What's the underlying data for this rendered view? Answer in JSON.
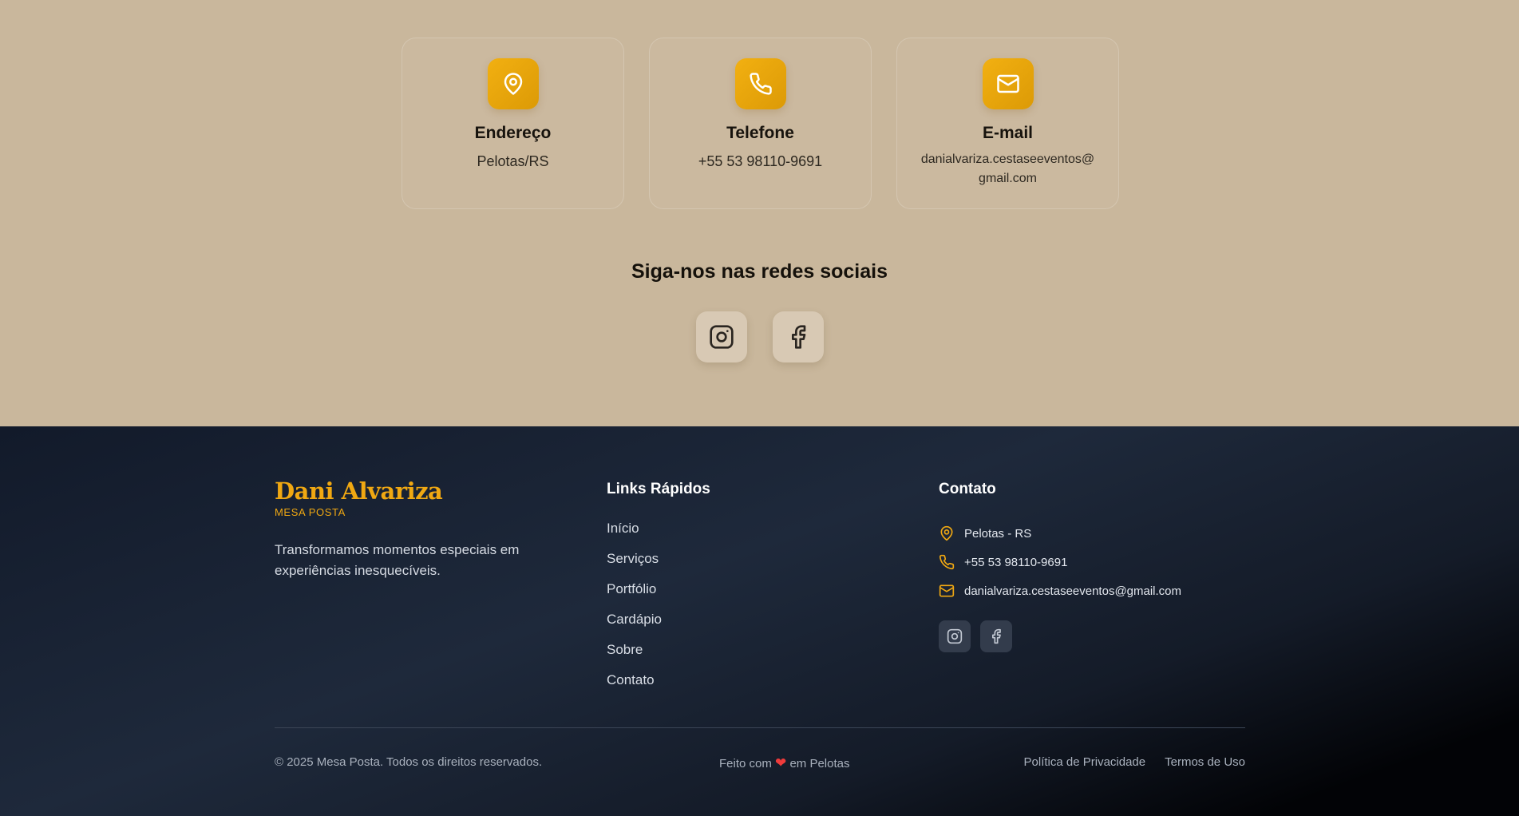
{
  "contact_cards": [
    {
      "title": "Endereço",
      "value": "Pelotas/RS",
      "icon": "map-pin-icon"
    },
    {
      "title": "Telefone",
      "value": "+55 53 98110-9691",
      "icon": "phone-icon"
    },
    {
      "title": "E-mail",
      "value": "danialvariza.cestaseeventos@gmail.com",
      "icon": "mail-icon"
    }
  ],
  "social": {
    "title": "Siga-nos nas redes sociais",
    "items": [
      {
        "icon": "instagram-icon"
      },
      {
        "icon": "facebook-icon"
      }
    ]
  },
  "footer": {
    "brand_name": "Dani Alvariza",
    "brand_sub": "MESA POSTA",
    "description": "Transformamos momentos especiais em experiências inesquecíveis.",
    "links_title": "Links Rápidos",
    "links": [
      "Início",
      "Serviços",
      "Portfólio",
      "Cardápio",
      "Sobre",
      "Contato"
    ],
    "contact_title": "Contato",
    "contact_items": [
      {
        "icon": "map-pin-icon",
        "text": "Pelotas - RS"
      },
      {
        "icon": "phone-icon",
        "text": "+55 53 98110-9691"
      },
      {
        "icon": "mail-icon",
        "text": "danialvariza.cestaseeventos@gmail.com"
      }
    ],
    "copyright": "© 2025 Mesa Posta. Todos os direitos reservados.",
    "made_with_prefix": "Feito com",
    "made_with_suffix": "em Pelotas",
    "privacy": "Política de Privacidade",
    "terms": "Termos de Uso"
  },
  "colors": {
    "accent": "#f0a812",
    "section_bg": "#c9b79c",
    "footer_bg": "#1e293b",
    "heart": "#ef3b3b"
  }
}
